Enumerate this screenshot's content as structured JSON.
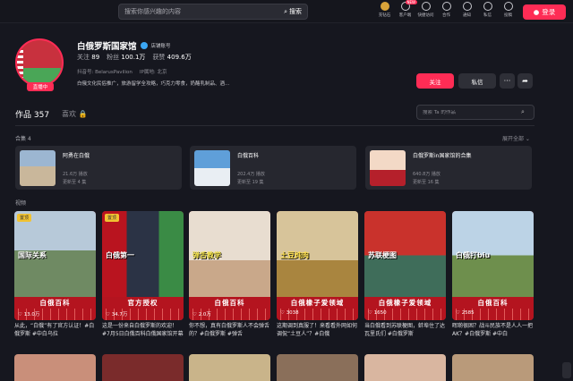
{
  "header": {
    "search_placeholder": "搜索你感兴趣的内容",
    "search_button": "搜索",
    "icons": [
      {
        "label": "充钻石",
        "icon": "diamond-icon"
      },
      {
        "label": "客户端",
        "icon": "client-icon",
        "badge": "NEW"
      },
      {
        "label": "快捷访问",
        "icon": "star-icon"
      },
      {
        "label": "合作",
        "icon": "coop-icon"
      },
      {
        "label": "通知",
        "icon": "bell-icon"
      },
      {
        "label": "私信",
        "icon": "message-icon"
      },
      {
        "label": "投稿",
        "icon": "upload-icon"
      }
    ],
    "login": "登录"
  },
  "profile": {
    "name": "白俄罗斯国家馆",
    "verified_text": "店铺账号",
    "live_badge": "直播中",
    "follow_label": "关注",
    "follow_count": "89",
    "fans_label": "粉丝",
    "fans_count": "100.1万",
    "likes_label": "获赞",
    "likes_count": "409.6万",
    "douyin_id": "抖音号: BelarusPavilion",
    "ip": "IP属地: 北京",
    "bio": "白俄文化民俗推广，旅游留学全攻略，巧克力零食，奶酪乳制品、酒…",
    "follow_btn": "关注",
    "msg_btn": "私信",
    "more_btn": "···",
    "share_btn": "➦"
  },
  "tabs": {
    "works": "作品 357",
    "liked": "喜欢",
    "search_placeholder": "搜索 Ta 的作品"
  },
  "collections": {
    "label": "合集 4",
    "expand": "展开全部 ⌄",
    "items": [
      {
        "title": "阿勇在白俄",
        "plays": "21.6万 播放",
        "updated": "更新至 4 集"
      },
      {
        "title": "白俄百科",
        "plays": "202.4万 播放",
        "updated": "更新至 19 集"
      },
      {
        "title": "白俄罗斯in国家馆的合集",
        "plays": "640.8万 播放",
        "updated": "更新至 16 集"
      }
    ]
  },
  "videos": {
    "label": "视频",
    "items": [
      {
        "pin": "置顶",
        "overlay": "国际关系",
        "strip": "白俄百科",
        "likes": "13.0万",
        "caption": "从此，“白俄”有了官方认证！#白俄罗斯 #中白乌拉"
      },
      {
        "pin": "置顶",
        "overlay": "白俄第一",
        "strip": "官方授权",
        "likes": "34.7万",
        "caption": "这是一份来自白俄罗斯的欢迎！#7月5日白俄百科白俄国家馆开幕"
      },
      {
        "pin": "",
        "overlay": "弹舌教学",
        "strip": "白俄百科",
        "likes": "2.0万",
        "caption": "你不想，真有白俄罗斯人不会弹舌的？#白俄罗斯 #弹舌"
      },
      {
        "pin": "",
        "overlay": "土豆炖肉",
        "strip": "白俄橡子爱领域",
        "likes": "3038",
        "caption": "这期调到真服了！来看看外网如何调侃“土豆人”？#白俄"
      },
      {
        "pin": "",
        "overlay": "苏联梗图",
        "strip": "白俄橡子爱领域",
        "likes": "1650",
        "caption": "当白俄看到苏联梗图，蚌埠住了达瓦里氏们 #白俄罗斯"
      },
      {
        "pin": "",
        "overlay": "白俄打biu",
        "strip": "白俄百科",
        "likes": "2585",
        "caption": "晖啲很困？战斗民族不是人人一把AK？#白俄罗斯 #中白"
      }
    ]
  }
}
